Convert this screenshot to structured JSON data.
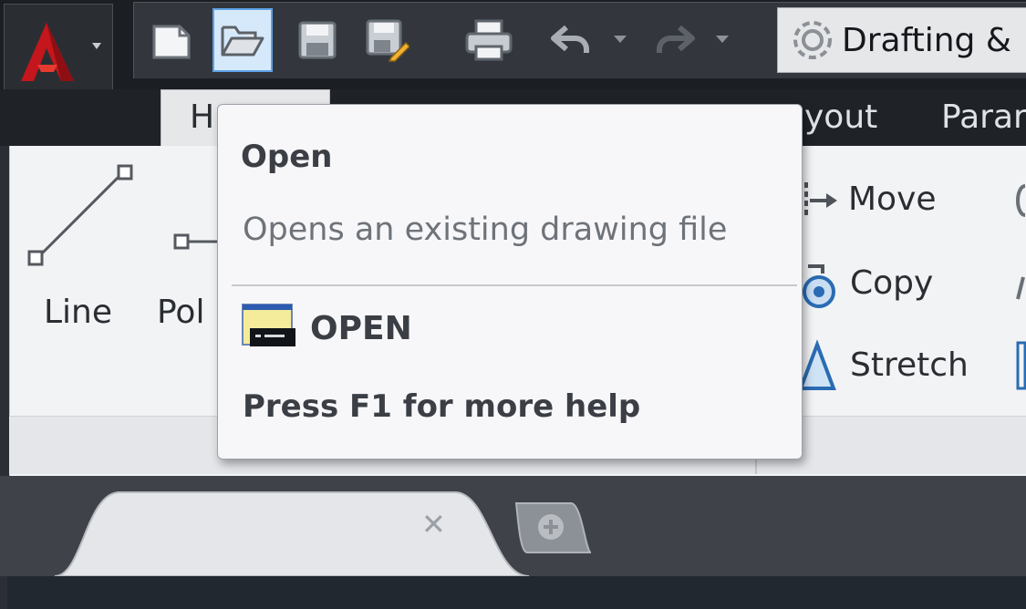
{
  "app": {
    "logo": "autocad-a-logo"
  },
  "quick_access": {
    "buttons": [
      {
        "name": "new",
        "icon": "new-file-icon"
      },
      {
        "name": "open",
        "icon": "open-folder-icon",
        "active": true
      },
      {
        "name": "save",
        "icon": "save-icon"
      },
      {
        "name": "save-as",
        "icon": "save-as-icon"
      },
      {
        "name": "plot",
        "icon": "printer-icon"
      },
      {
        "name": "undo",
        "icon": "undo-icon"
      },
      {
        "name": "redo",
        "icon": "redo-icon"
      }
    ],
    "workspace": {
      "icon": "gear-icon",
      "label": "Drafting &"
    }
  },
  "ribbon_tabs": [
    {
      "label": "H",
      "active": true
    },
    {
      "label": "yout"
    },
    {
      "label": "Parar"
    }
  ],
  "draw_panel": {
    "line_label": "Line",
    "polyline_label": "Pol"
  },
  "modify_panel": {
    "move_label": "Move",
    "copy_label": "Copy",
    "stretch_label": "Stretch"
  },
  "tooltip": {
    "title": "Open",
    "description": "Opens an existing drawing file",
    "command": "OPEN",
    "help": "Press F1 for more help"
  },
  "file_tabs": {
    "close_glyph": "✕",
    "new_tab_glyph": "+"
  },
  "colors": {
    "accent_active": "#5ea2e6",
    "logo_red": "#c4161c",
    "tooltip_bg": "#f7f7f9"
  }
}
